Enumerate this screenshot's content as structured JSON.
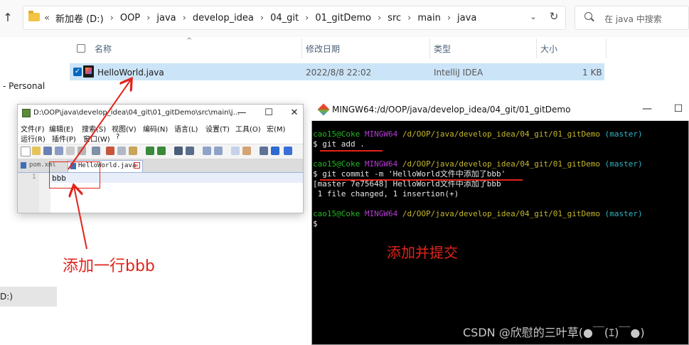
{
  "explorer": {
    "back_icon": "arrow-up-icon",
    "breadcrumb_lead": "«",
    "breadcrumb": [
      "新加卷 (D:)",
      "OOP",
      "java",
      "develop_idea",
      "04_git",
      "01_gitDemo",
      "src",
      "main",
      "java"
    ],
    "search_placeholder": "在 java 中搜索",
    "nav_personal": "- Personal",
    "nav_drive": "D:)",
    "columns": {
      "name": "名称",
      "modified": "修改日期",
      "type": "类型",
      "size": "大小"
    },
    "files": [
      {
        "name": "HelloWorld.java",
        "modified": "2022/8/8 22:02",
        "type": "IntelliJ IDEA",
        "size": "1 KB"
      }
    ]
  },
  "ide": {
    "title": "D:\\OOP\\java\\develop_idea\\04_git\\01_gitDemo\\src\\main\\j...",
    "window_buttons": [
      "—",
      "☐",
      "✕"
    ],
    "menu_row1": [
      "文件(F)",
      "编辑(E)",
      "搜索(S)",
      "视图(V)",
      "编码(N)",
      "语言(L)",
      "设置(T)",
      "工具(O)",
      "宏(M)"
    ],
    "menu_row2": [
      "运行(R)",
      "插件(P)",
      "窗口(W)",
      "?"
    ],
    "tabs": [
      "pom.xml",
      "HelloWorld.java"
    ],
    "line_number": "1",
    "code_line": "bbb"
  },
  "terminal": {
    "title": "MINGW64:/d/OOP/java/develop_idea/04_git/01_gitDemo",
    "window_buttons": [
      "—",
      "☐"
    ],
    "prompt_user": "cao15@Coke",
    "prompt_sys": "MINGW64",
    "prompt_path": "/d/OOP/java/develop_idea/04_git/01_gitDemo",
    "prompt_branch": "(master)",
    "cmd1": "$ git add .",
    "cmd2": "$ git commit -m 'HelloWorld文件中添加了bbb'",
    "out1": "[master 7e75648] HelloWorld文件中添加了bbb",
    "out2": " 1 file changed, 1 insertion(+)",
    "cmd3": "$"
  },
  "annotations": {
    "add_line": "添加一行bbb",
    "add_commit": "添加并提交",
    "color": "#e2241b"
  },
  "watermark": "CSDN @欣慰的三叶草(●￣(ｴ)￣●)"
}
